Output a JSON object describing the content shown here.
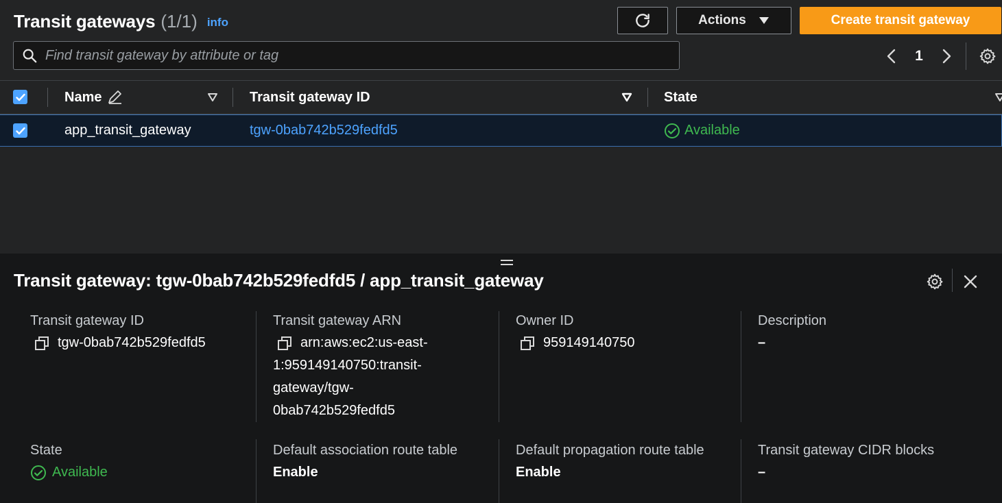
{
  "header": {
    "title": "Transit gateways",
    "count": "(1/1)",
    "info_label": "info",
    "refresh_icon": "refresh-icon",
    "actions_label": "Actions",
    "create_label": "Create transit gateway"
  },
  "search": {
    "placeholder": "Find transit gateway by attribute or tag"
  },
  "pagination": {
    "current_page": "1"
  },
  "table": {
    "columns": [
      {
        "label": "Name"
      },
      {
        "label": "Transit gateway ID"
      },
      {
        "label": "State"
      }
    ],
    "rows": [
      {
        "name": "app_transit_gateway",
        "id": "tgw-0bab742b529fedfd5",
        "state": "Available",
        "selected": true
      }
    ]
  },
  "details": {
    "title": "Transit gateway: tgw-0bab742b529fedfd5 / app_transit_gateway",
    "fields": [
      {
        "label": "Transit gateway ID",
        "value": "tgw-0bab742b529fedfd5"
      },
      {
        "label": "Transit gateway ARN",
        "value": "arn:aws:ec2:us-east-1:959149140750:transit-gateway/tgw-0bab742b529fedfd5"
      },
      {
        "label": "Owner ID",
        "value": "959149140750"
      },
      {
        "label": "Description",
        "value": "–"
      },
      {
        "label": "State",
        "value": "Available"
      },
      {
        "label": "Default association route table",
        "value": "Enable"
      },
      {
        "label": "Default propagation route table",
        "value": "Enable"
      },
      {
        "label": "Transit gateway CIDR blocks",
        "value": "–"
      }
    ]
  },
  "colors": {
    "accent_orange": "#f89a17",
    "link_blue": "#4da3ff",
    "success_green": "#3fb950",
    "background_dark": "#232425",
    "panel_dark": "#161718"
  }
}
